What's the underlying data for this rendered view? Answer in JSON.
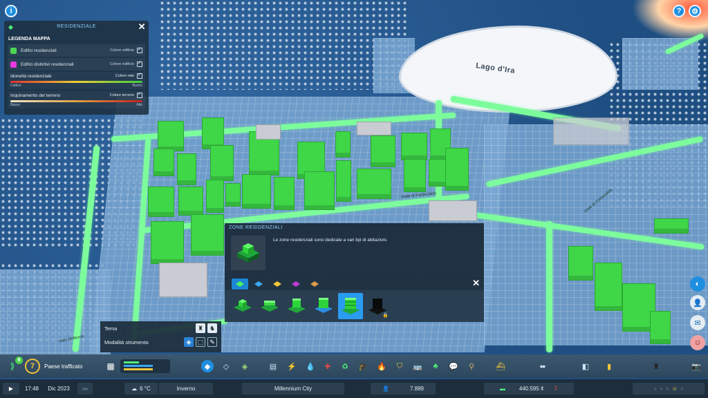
{
  "map": {
    "lake_label": "Lago d'Ira",
    "road_labels": [
      "Viale di Fontecalda",
      "Viale di Fontecalda",
      "Viale Bellevue"
    ]
  },
  "top_bar": {
    "info_icon": "info-icon",
    "help_icon": "help-icon",
    "settings_icon": "gear-icon"
  },
  "legend": {
    "header": "RESIDENZIALE",
    "title": "LEGENDA MAPPA",
    "close": "✕",
    "rows": [
      {
        "label": "Edifici residenziali",
        "right": "Colore edificio",
        "color": "#4cd656"
      },
      {
        "label": "Edifici distintivi residenziali",
        "right": "Colore edificio",
        "color": "#e63be0"
      }
    ],
    "gradients": [
      {
        "label": "Idoneità residenziale",
        "right": "Colore rete",
        "low": "Cattivo",
        "high": "Buono"
      },
      {
        "label": "Inquinamento del terreno",
        "right": "Colore terreno",
        "low": "Basso",
        "high": "Alto"
      }
    ]
  },
  "zone_panel": {
    "header": "ZONE RESIDENZIALI",
    "description": "Le zone residenziali sono dedicate a vari tipi di abitazioni.",
    "close": "✕"
  },
  "tool_panel": {
    "theme_label": "Tema",
    "mode_label": "Modalità strumento"
  },
  "toolbar": {
    "milestone_number": "7",
    "milestone_label": "Paese trafficato",
    "progress_badge": "9"
  },
  "status_bar": {
    "time": "17:48",
    "date": "Dic 2023",
    "temperature": "6 °C",
    "season": "Inverno",
    "city_name": "Millennium City",
    "population": "7.889",
    "money": "440.595 ¢"
  },
  "colors": {
    "zone_green": "#3fd648",
    "road_green": "#7dfc9c",
    "accent_blue": "#1f8fe0"
  }
}
